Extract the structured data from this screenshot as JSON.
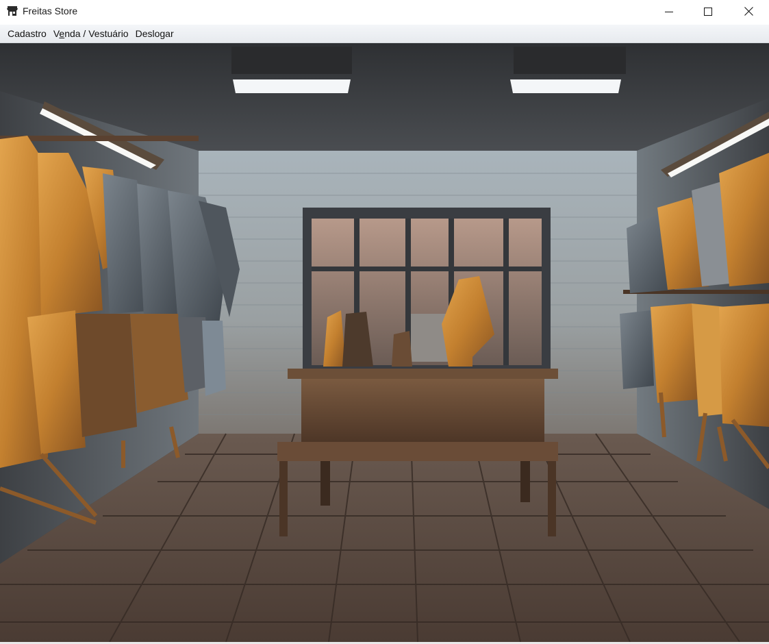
{
  "window": {
    "title": "Freitas Store",
    "icon": "store-icon",
    "controls": {
      "minimize_icon": "minimize-icon",
      "maximize_icon": "maximize-icon",
      "close_icon": "close-icon"
    }
  },
  "menu": {
    "items": [
      {
        "label_pre": "Cadastro",
        "label_mn": "",
        "label_post": ""
      },
      {
        "label_pre": "V",
        "label_mn": "e",
        "label_post": "nda / Vestuário"
      },
      {
        "label_pre": "Deslogar",
        "label_mn": "",
        "label_post": ""
      }
    ]
  },
  "content": {
    "image": "clothing-store-interior-image",
    "colors": {
      "wall": "#8a939a",
      "ceiling": "#3b3d40",
      "floor": "#5a4a40",
      "garment_gold": "#c98a3a",
      "garment_grey": "#5d6670",
      "table_wood": "#5e4330"
    }
  }
}
